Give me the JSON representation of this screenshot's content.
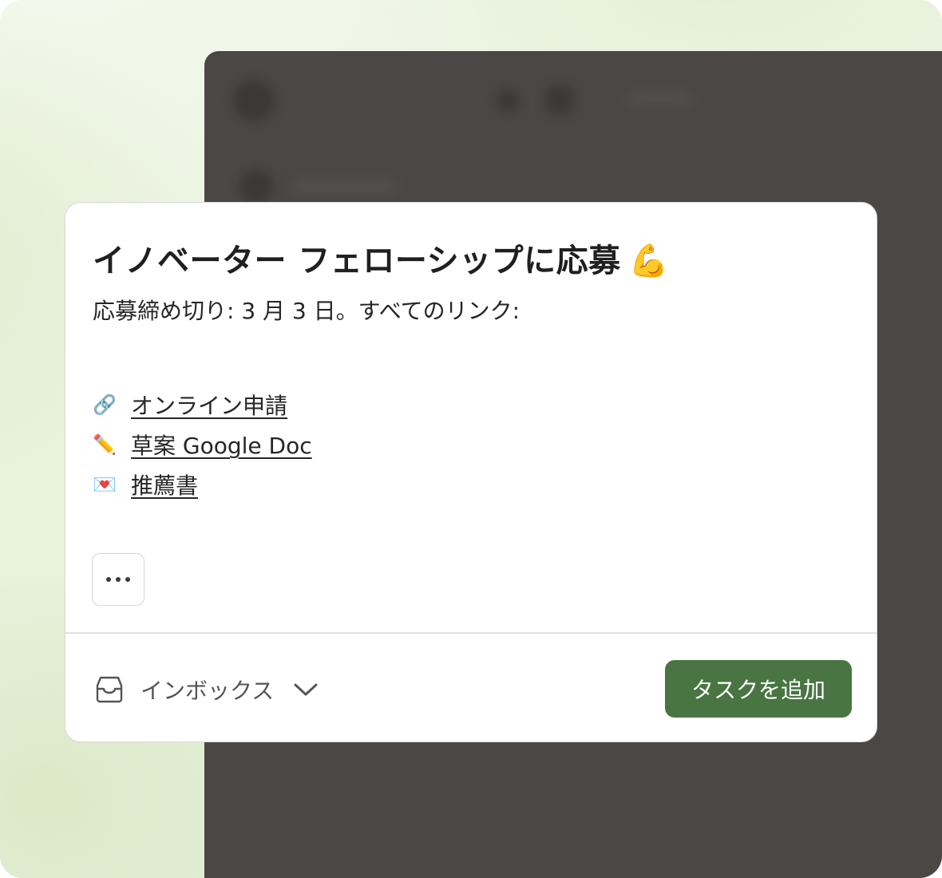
{
  "task": {
    "title": "イノベーター フェローシップに応募",
    "title_emoji": "💪",
    "description": "応募締め切り: 3 月 3 日。すべてのリンク:",
    "links": [
      {
        "emoji": "🔗",
        "label": "オンライン申請"
      },
      {
        "emoji": "✏️",
        "label": "草案 Google Doc"
      },
      {
        "emoji": "💌",
        "label": "推薦書"
      }
    ]
  },
  "footer": {
    "project_label": "インボックス",
    "add_button_label": "タスクを追加"
  },
  "colors": {
    "accent": "#487542",
    "background_panel": "#4a4744"
  }
}
